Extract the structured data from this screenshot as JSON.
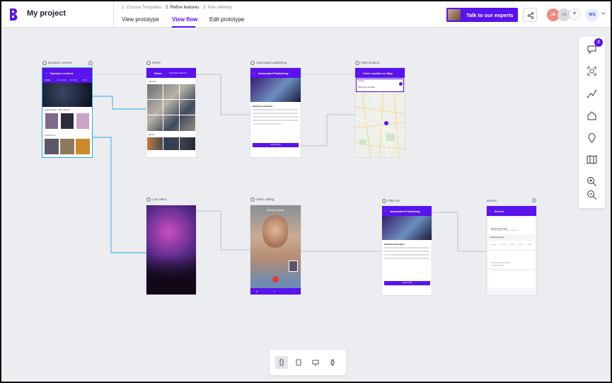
{
  "header": {
    "project_title": "My project",
    "steps": [
      "1. Choose Templates",
      "2. Refine features",
      "3. Plan delivery"
    ],
    "tabs": [
      {
        "label": "View prototype"
      },
      {
        "label": "View flow"
      },
      {
        "label": "Edit prototype"
      }
    ],
    "expert_button": "Talk to our experts",
    "collaborators": [
      {
        "initials": "JB"
      },
      {
        "initials": "+3"
      }
    ],
    "current_user": "WQ"
  },
  "toolbar": {
    "comment_badge": "2"
  },
  "colors": {
    "brand": "#5a12ee",
    "selection": "#28a9e0",
    "canvas": "#ecedf1"
  },
  "nodes": {
    "dynamic_content": {
      "label": "Dynamic content",
      "appbar_title": "Dynamic content",
      "tabs": [
        "HOME",
        "TV SHOWS",
        "MOVIES",
        "KIDS"
      ],
      "section1": "Latest episode - daily collection",
      "section2": "Trending now"
    },
    "share": {
      "label": "Share",
      "appbar_title": "Share",
      "sublabel": "Currently selected",
      "row1": "February",
      "row2": "March"
    },
    "automated_publishing": {
      "label": "Automated publishing",
      "appbar_title": "Automated Publishing",
      "section": "Workflow automation",
      "button": "Verify & Add"
    },
    "view_location": {
      "label": "View location",
      "appbar_title": "View Location on Map",
      "field1": "Address",
      "field2": "Melbourne, Australia"
    },
    "live_video": {
      "label": "Live video"
    },
    "video_calling": {
      "label": "Video calling",
      "caller": "Nicholas Cayman"
    },
    "filter_list": {
      "label": "Filter list",
      "appbar_title": "Automated Publishing",
      "section": "Workflow automation",
      "button": "Verify & Add"
    },
    "events": {
      "label": "Events",
      "appbar_title": "Events",
      "card_title": "Meeting with client",
      "card_sub": "Tuesday, 3:00pm - 6:30 pm · Room 12",
      "section": "Created Following",
      "filters": [
        "Location",
        "Friends",
        "Date",
        "Price",
        "Music"
      ]
    }
  }
}
